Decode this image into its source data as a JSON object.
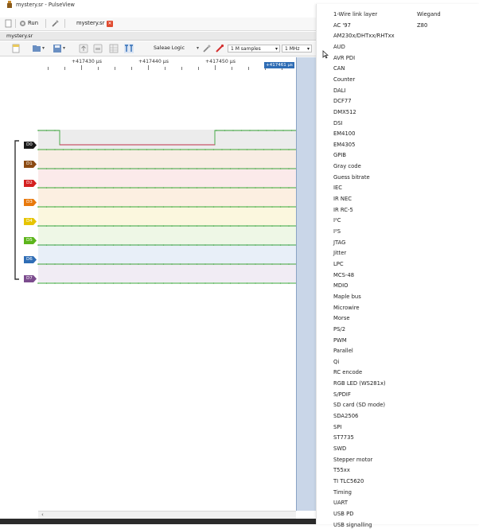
{
  "window": {
    "title": "mystery.sr - PulseView",
    "run_label": "Run",
    "tab_label": "mystery.sr",
    "doc_label": "mystery.sr"
  },
  "toolbar": {
    "device": "Saleae Logic",
    "samples": "1 M samples",
    "samplerate": "1 MHz"
  },
  "ruler": {
    "labels": [
      "+417430 µs",
      "+417440 µs",
      "+417450 µs"
    ],
    "cursor": "+417461 µs"
  },
  "channels": [
    {
      "name": "D0",
      "color": "#1a1a1a"
    },
    {
      "name": "D1",
      "color": "#8b4a12"
    },
    {
      "name": "D2",
      "color": "#d42020"
    },
    {
      "name": "D3",
      "color": "#e8790c"
    },
    {
      "name": "D4",
      "color": "#e6c400"
    },
    {
      "name": "D5",
      "color": "#5cb51c"
    },
    {
      "name": "D6",
      "color": "#2f6db5"
    },
    {
      "name": "D7",
      "color": "#7c4c8e"
    }
  ],
  "colors": {
    "trace_green": "#3aa53a",
    "trace_red": "#c0304a",
    "cursor_blue": "#2f6db5"
  },
  "menu": {
    "col2": [
      "Wiegand",
      "Z80"
    ],
    "items": [
      "1-Wire link layer",
      "AC '97",
      "AM230x/DHTxx/RHTxx",
      "AUD",
      "AVR PDI",
      "CAN",
      "Counter",
      "DALI",
      "DCF77",
      "DMX512",
      "DSI",
      "EM4100",
      "EM4305",
      "GPIB",
      "Gray code",
      "Guess bitrate",
      "IEC",
      "IR NEC",
      "IR RC-5",
      "I²C",
      "I²S",
      "JTAG",
      "Jitter",
      "LPC",
      "MCS-48",
      "MDIO",
      "Maple bus",
      "Microwire",
      "Morse",
      "PS/2",
      "PWM",
      "Parallel",
      "Qi",
      "RC encode",
      "RGB LED (WS281x)",
      "S/PDIF",
      "SD card (SD mode)",
      "SDA2506",
      "SPI",
      "ST7735",
      "SWD",
      "Stepper motor",
      "T55xx",
      "TI TLC5620",
      "Timing",
      "UART",
      "USB PD",
      "USB signalling"
    ]
  }
}
